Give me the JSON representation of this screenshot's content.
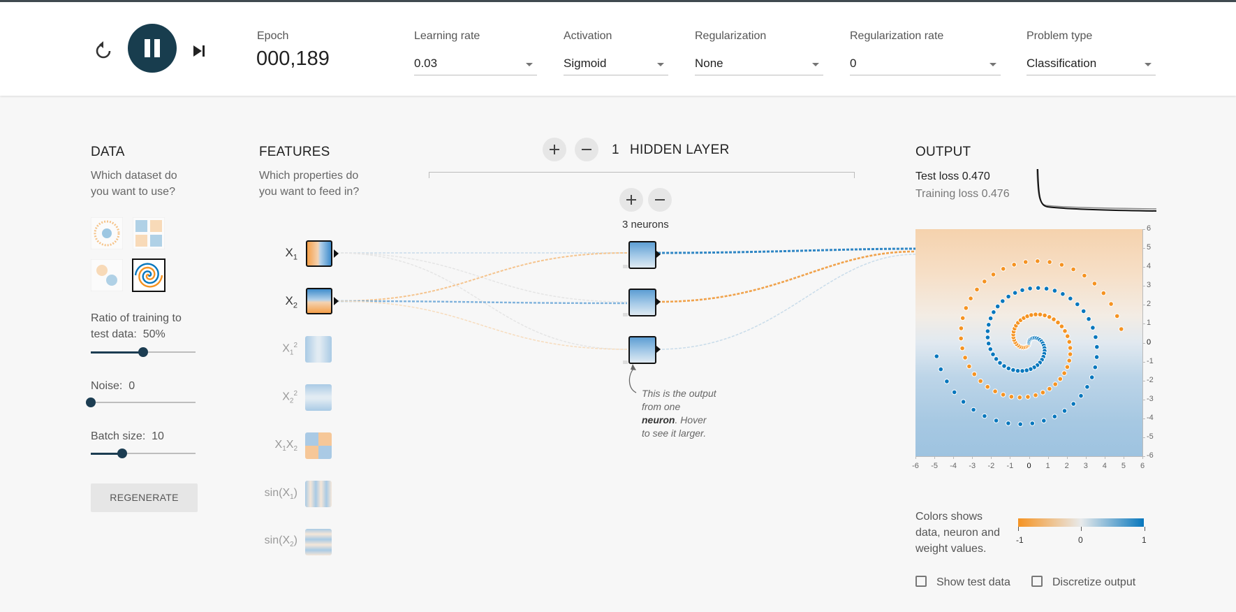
{
  "controls": {
    "reset_icon": "reset-icon",
    "pause_icon": "pause-icon",
    "step_icon": "step-forward-icon",
    "epoch_label": "Epoch",
    "epoch_value": "000,189",
    "learning_rate_label": "Learning rate",
    "learning_rate_value": "0.03",
    "activation_label": "Activation",
    "activation_value": "Sigmoid",
    "regularization_label": "Regularization",
    "regularization_value": "None",
    "reg_rate_label": "Regularization rate",
    "reg_rate_value": "0",
    "problem_type_label": "Problem type",
    "problem_type_value": "Classification"
  },
  "data_panel": {
    "title": "DATA",
    "subtitle": "Which dataset do you want to use?",
    "ratio_label": "Ratio of training to test data:",
    "ratio_value": "50%",
    "ratio_fraction": 0.5,
    "noise_label": "Noise:",
    "noise_value": "0",
    "noise_fraction": 0,
    "batch_label": "Batch size:",
    "batch_value": "10",
    "batch_fraction": 0.3,
    "regenerate_label": "REGENERATE"
  },
  "features_panel": {
    "title": "FEATURES",
    "subtitle": "Which properties do you want to feed in?"
  },
  "network": {
    "hidden_layers_count": "1",
    "hidden_layers_label": "HIDDEN LAYER",
    "neurons_label": "3 neurons",
    "hint_line1": "This is the output",
    "hint_line2": "from one",
    "hint_bold": "neuron",
    "hint_line3_rest": ". Hover",
    "hint_line4": "to see it larger."
  },
  "output_panel": {
    "title": "OUTPUT",
    "test_loss_label": "Test loss",
    "test_loss_value": "0.470",
    "training_loss_label": "Training loss",
    "training_loss_value": "0.476",
    "colors_text_line1": "Colors shows",
    "colors_text_line2": "data, neuron and",
    "colors_text_line3": "weight values.",
    "scale_min": "-1",
    "scale_mid": "0",
    "scale_max": "1",
    "show_test_label": "Show test data",
    "discretize_label": "Discretize output"
  },
  "colors": {
    "orange": "#f59322",
    "blue": "#0877bd",
    "dark": "#183d4e"
  },
  "chart_data": {
    "type": "scatter",
    "xlim": [
      -6,
      6
    ],
    "ylim": [
      -6,
      6
    ],
    "x_ticks": [
      "-6",
      "-5",
      "-4",
      "-3",
      "-2",
      "-1",
      "0",
      "1",
      "2",
      "3",
      "4",
      "5",
      "6"
    ],
    "y_ticks": [
      "6",
      "5",
      "4",
      "3",
      "2",
      "1",
      "0",
      "-1",
      "-2",
      "-3",
      "-4",
      "-5",
      "-6"
    ],
    "series": [
      {
        "color": "#f59322",
        "spiral_phase": 3.14159
      },
      {
        "color": "#0877bd",
        "spiral_phase": 0
      }
    ]
  }
}
